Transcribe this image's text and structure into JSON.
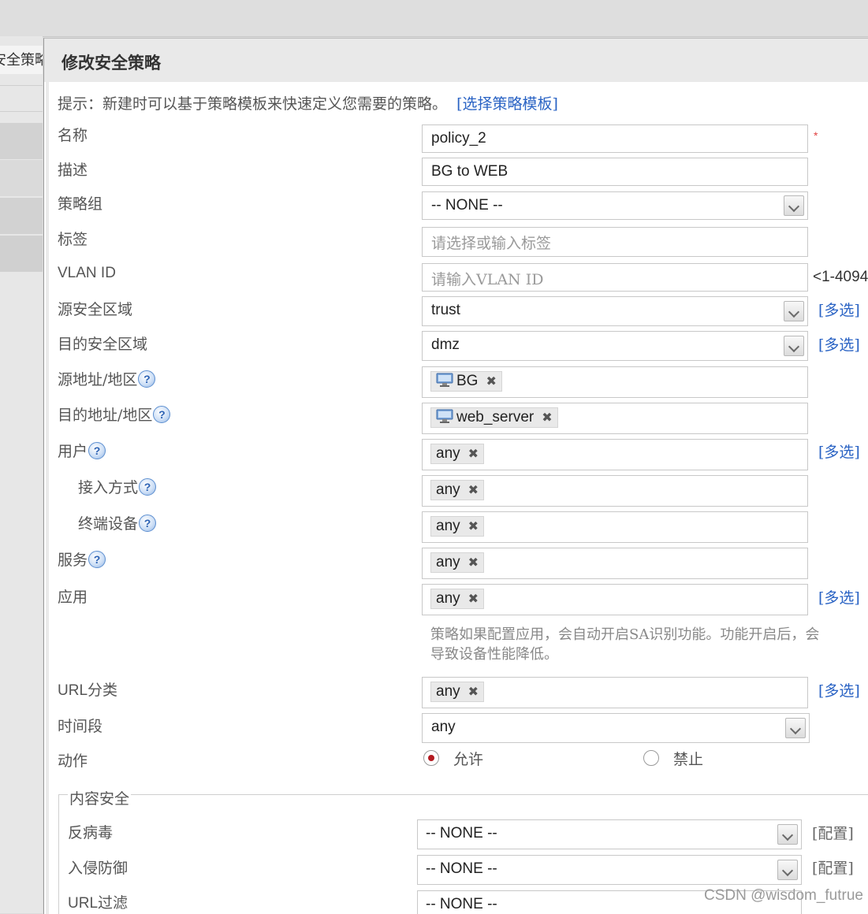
{
  "background": {
    "left_tab_label": "安全策略"
  },
  "dialog": {
    "title": "修改安全策略",
    "hint": "提示：新建时可以基于策略模板来快速定义您需要的策略。",
    "hint_link": "[选择策略模板]"
  },
  "form": {
    "name": {
      "label": "名称",
      "value": "policy_2",
      "required_mark": "*"
    },
    "description": {
      "label": "描述",
      "value": "BG to WEB"
    },
    "policy_group": {
      "label": "策略组",
      "value": "-- NONE --"
    },
    "tags": {
      "label": "标签",
      "placeholder": "请选择或输入标签"
    },
    "vlan_id": {
      "label": "VLAN ID",
      "placeholder": "请输入VLAN ID",
      "range_hint": "<1-4094"
    },
    "source_zone": {
      "label": "源安全区域",
      "value": "trust",
      "multi": "[多选]"
    },
    "destination_zone": {
      "label": "目的安全区域",
      "value": "dmz",
      "multi": "[多选]"
    },
    "source_address": {
      "label": "源地址/地区",
      "tag": "BG",
      "tag_icon": "computer-icon"
    },
    "destination_address": {
      "label": "目的地址/地区",
      "tag": "web_server",
      "tag_icon": "computer-icon"
    },
    "user": {
      "label": "用户",
      "tag": "any",
      "multi": "[多选]"
    },
    "access_method": {
      "label": "接入方式",
      "tag": "any"
    },
    "terminal_device": {
      "label": "终端设备",
      "tag": "any"
    },
    "service": {
      "label": "服务",
      "tag": "any"
    },
    "application": {
      "label": "应用",
      "tag": "any",
      "multi": "[多选]"
    },
    "application_note": "策略如果配置应用，会自动开启SA识别功能。功能开启后，会导致设备性能降低。",
    "url_category": {
      "label": "URL分类",
      "tag": "any",
      "multi": "[多选]"
    },
    "time_range": {
      "label": "时间段",
      "value": "any"
    },
    "action": {
      "label": "动作",
      "permit": "允许",
      "deny": "禁止",
      "selected": "permit"
    },
    "help_glyph": "?",
    "remove_glyph": "✖"
  },
  "content_security": {
    "legend": "内容安全",
    "antivirus": {
      "label": "反病毒",
      "value": "-- NONE --",
      "config": "[配置]"
    },
    "ips": {
      "label": "入侵防御",
      "value": "-- NONE --",
      "config": "[配置]"
    },
    "url_filter": {
      "label": "URL过滤",
      "value": "-- NONE --"
    }
  },
  "colors": {
    "link": "#2a63c4",
    "radio_selected": "#b3191f",
    "required": "#e04040"
  },
  "watermark": "CSDN @wisdom_futrue"
}
